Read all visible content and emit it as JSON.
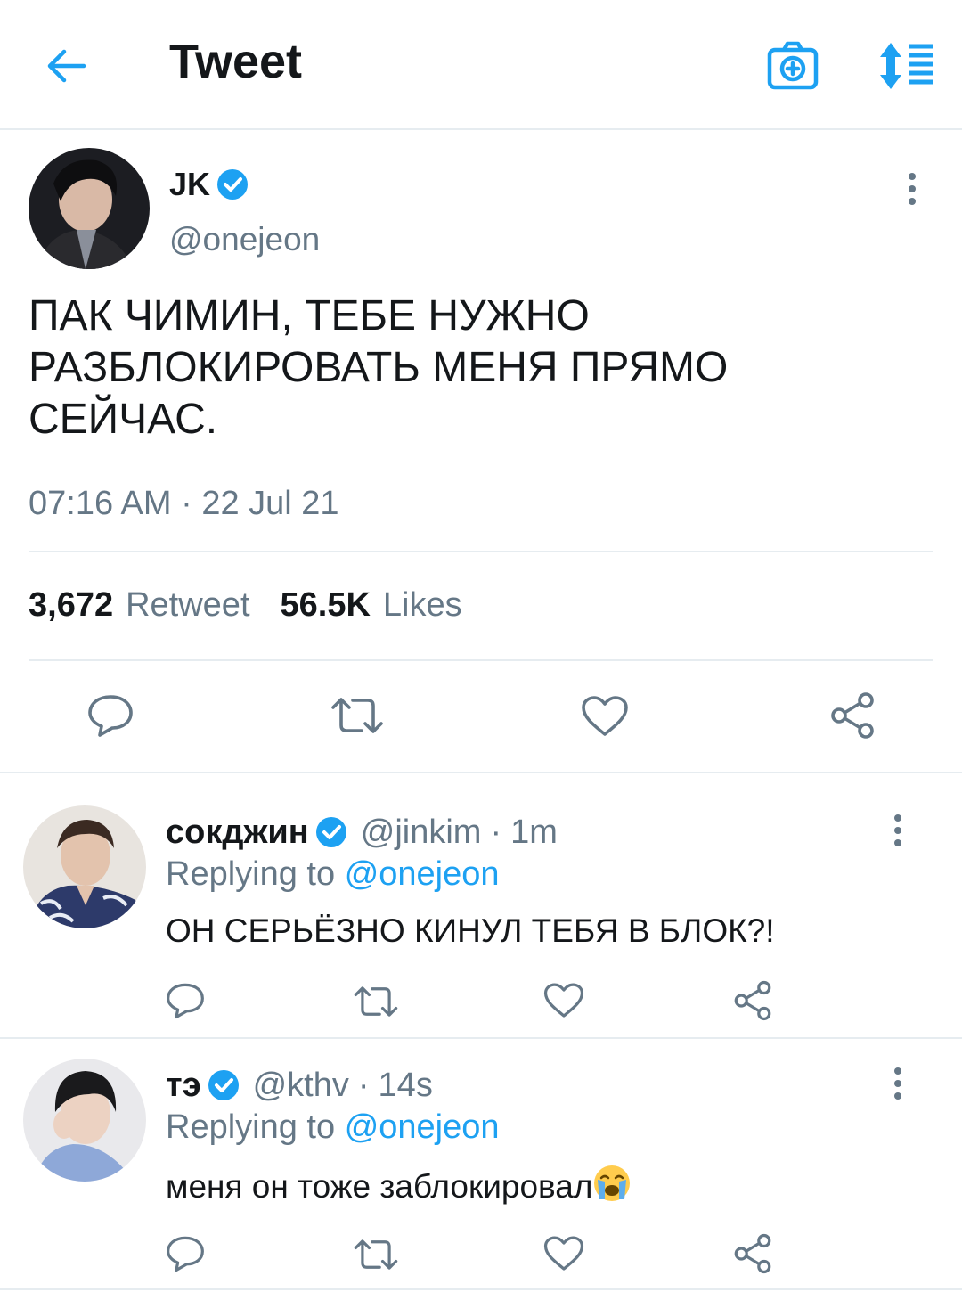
{
  "header": {
    "title": "Tweet",
    "back_icon": "arrow-left-icon",
    "camera_icon": "camera-icon",
    "sort_icon": "sort-icon",
    "accent": "#1da1f2"
  },
  "tweet": {
    "name": "JK",
    "handle": "@onejeon",
    "verified": true,
    "text_lines": [
      "ПАК ЧИМИН, ТЕБЕ НУЖНО",
      "РАЗБЛОКИРОВАТЬ МЕНЯ ПРЯМО",
      "СЕЙЧАС."
    ],
    "time": "07:16 AM · 22 Jul 21",
    "retweet_count": "3,672",
    "retweet_label": "Retweet",
    "likes_count": "56.5K",
    "likes_label": "Likes"
  },
  "replies": [
    {
      "name": "сокджин",
      "handle": "@jinkim",
      "age": "1m",
      "replying_prefix": "Replying to",
      "replying_to": "@onejeon",
      "text": "ОН СЕРЬЁЗНО КИНУЛ ТЕБЯ В БЛОК?!"
    },
    {
      "name": "тэ",
      "handle": "@kthv",
      "age": "14s",
      "replying_prefix": "Replying to",
      "replying_to": "@onejeon",
      "text": "меня он тоже заблокировал",
      "emoji": "loudly-crying-face-icon"
    }
  ],
  "colors": {
    "text": "#14171a",
    "secondary": "#657786",
    "link": "#1da1f2",
    "divider": "#e6ecf0"
  }
}
